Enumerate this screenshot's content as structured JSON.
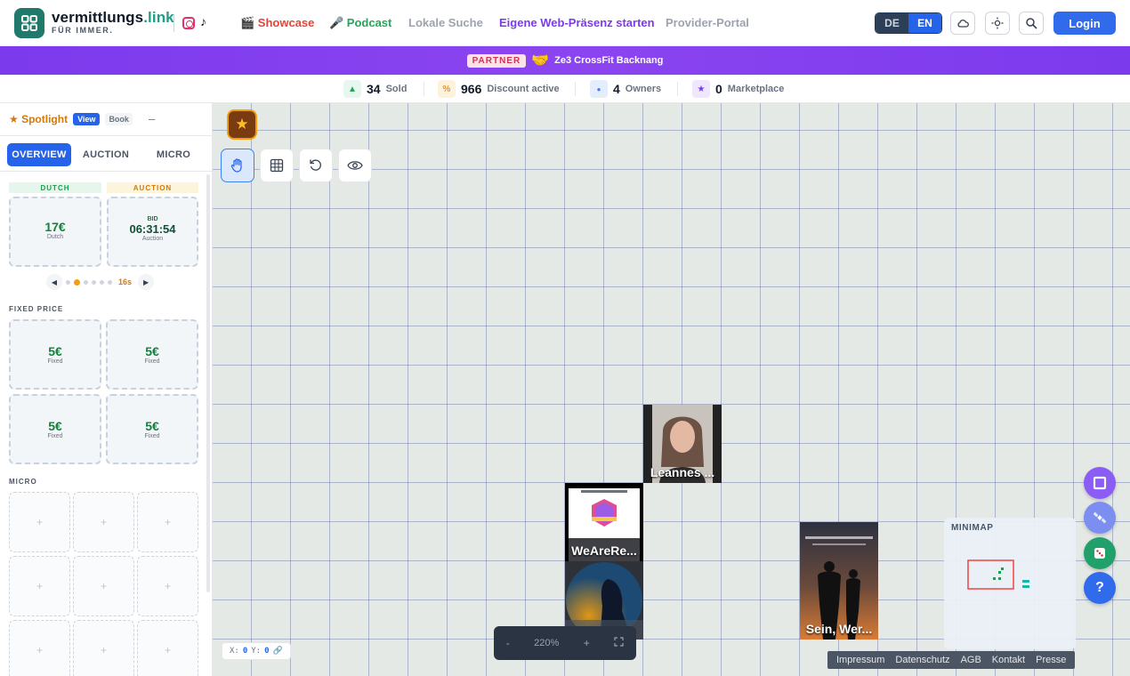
{
  "header": {
    "brand": "vermittlungs",
    "brand_suffix": ".link",
    "tagline": "FÜR IMMER.",
    "nav": {
      "showcase": "🎬 Showcase",
      "podcast": "🎤 Podcast",
      "lokale_suche": "Lokale Suche",
      "eigene": "Eigene Web-Präsenz starten",
      "provider": "Provider-Portal"
    },
    "lang": {
      "de": "DE",
      "en": "EN"
    },
    "login": "Login"
  },
  "banner": {
    "badge": "PARTNER",
    "emoji": "🤝",
    "text": "Ze3 CrossFit Backnang"
  },
  "stats": [
    {
      "icon": "▲",
      "value": "34",
      "label": "Sold"
    },
    {
      "icon": "%",
      "value": "966",
      "label": "Discount active"
    },
    {
      "icon": "●",
      "value": "4",
      "label": "Owners"
    },
    {
      "icon": "★",
      "value": "0",
      "label": "Marketplace"
    }
  ],
  "sidebar": {
    "title": "★ Spotlight",
    "view": "View",
    "book": "Book",
    "collapse": "–",
    "tabs": [
      "OVERVIEW",
      "AUCTION",
      "MICRO"
    ],
    "dutch_label": "DUTCH",
    "auction_label": "AUCTION",
    "dutch_card": {
      "price": "17€",
      "sub": "Dutch"
    },
    "auction_card": {
      "bid": "BID",
      "timer": "06:31:54",
      "sub": "Auction"
    },
    "pager": {
      "prev": "◀",
      "next": "▶",
      "seconds": "16s"
    },
    "fixed_label": "FIXED PRICE",
    "fixed": [
      {
        "price": "5€",
        "sub": "Fixed"
      },
      {
        "price": "5€",
        "sub": "Fixed"
      },
      {
        "price": "5€",
        "sub": "Fixed"
      },
      {
        "price": "5€",
        "sub": "Fixed"
      }
    ],
    "micro_label": "MICRO",
    "micro_plus": "+"
  },
  "canvas": {
    "tiles": {
      "leannes": "Leannes ...",
      "wearere": "WeAreRe...",
      "sein": "Sein, Wer..."
    },
    "coords": {
      "x_label": "X:",
      "x": "0",
      "y_label": "Y:",
      "y": "0"
    },
    "zoom": {
      "minus": "-",
      "level": "220%",
      "plus": "+"
    },
    "minimap_title": "MINIMAP",
    "fab_help": "?"
  },
  "footer": [
    "Impressum",
    "Datenschutz",
    "AGB",
    "Kontakt",
    "Presse"
  ],
  "colors": {
    "accent": "#2563eb",
    "banner": "#7c3aed",
    "brand": "#1f7a6b"
  }
}
